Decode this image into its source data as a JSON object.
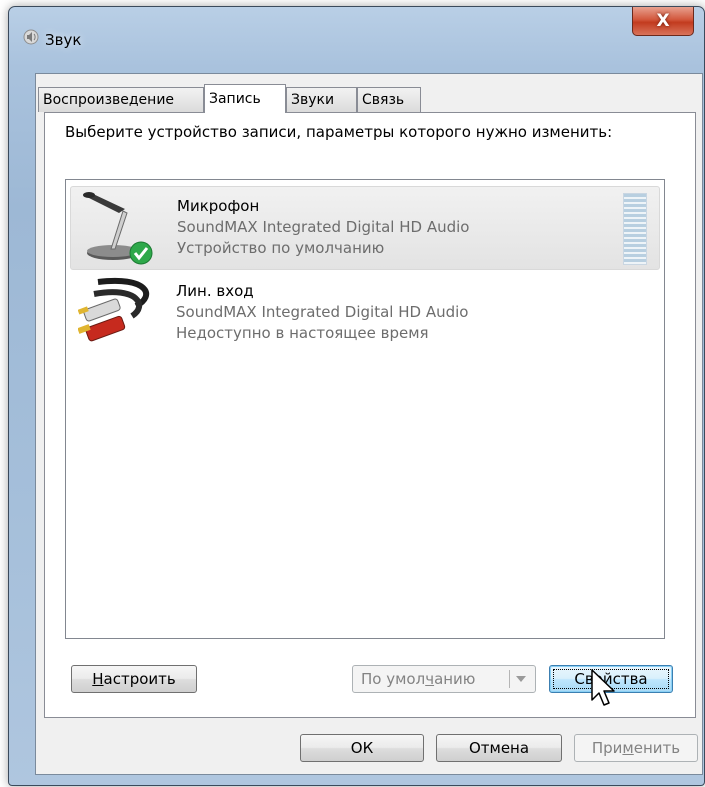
{
  "window": {
    "title": "Звук",
    "close_label": "X"
  },
  "tabs": [
    {
      "label": "Воспроизведение"
    },
    {
      "label": "Запись"
    },
    {
      "label": "Звуки"
    },
    {
      "label": "Связь"
    }
  ],
  "active_tab": "Запись",
  "instruction": "Выберите устройство записи, параметры которого нужно изменить:",
  "devices": [
    {
      "name": "Микрофон",
      "description": "SoundMAX Integrated Digital HD Audio",
      "status": "Устройство по умолчанию",
      "icon": "microphone-icon",
      "selected": true
    },
    {
      "name": "Лин. вход",
      "description": "SoundMAX Integrated Digital HD Audio",
      "status": "Недоступно в настоящее время",
      "icon": "rca-cable-icon",
      "selected": false
    }
  ],
  "buttons": {
    "configure": {
      "label_pre": "",
      "label_u": "Н",
      "label_post": "астроить"
    },
    "set_default": {
      "label_pre": "По умол",
      "label_u": "ч",
      "label_post": "анию"
    },
    "properties": {
      "label": "Свойства"
    },
    "ok": {
      "label": "ОК"
    },
    "cancel": {
      "label": "Отмена"
    },
    "apply": {
      "label_pre": "При",
      "label_u": "м",
      "label_post": "енить"
    }
  },
  "colors": {
    "default_check": "#2ea84a",
    "titlebar": "#a9c2dd",
    "close_button": "#c94a2e"
  }
}
